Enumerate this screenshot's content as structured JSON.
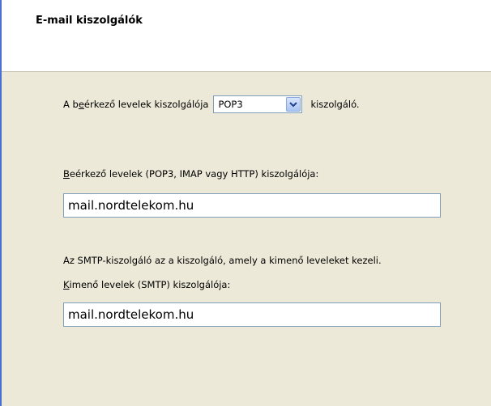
{
  "header": {
    "title": "E-mail kiszolgálók"
  },
  "incoming_type": {
    "label_pre": "A b",
    "label_accel": "e",
    "label_post": "érkező levelek kiszolgálója",
    "selected": "POP3",
    "suffix": "kiszolgáló."
  },
  "incoming_server": {
    "label_accel": "B",
    "label_rest": "eérkező levelek (POP3, IMAP vagy HTTP) kiszolgálója:",
    "value": "mail.nordtelekom.hu"
  },
  "smtp_note": "Az SMTP-kiszolgáló az a kiszolgáló, amely a kimenő leveleket kezeli.",
  "outgoing_server": {
    "label_accel": "K",
    "label_rest": "imenő levelek (SMTP) kiszolgálója:",
    "value": "mail.nordtelekom.hu"
  },
  "colors": {
    "panel_bg": "#ece9d8",
    "header_bg": "#ffffff",
    "field_border": "#7f9db9",
    "accent_edge": "#4a6fd1"
  },
  "icons": {
    "dropdown": "chevron-down-icon"
  }
}
